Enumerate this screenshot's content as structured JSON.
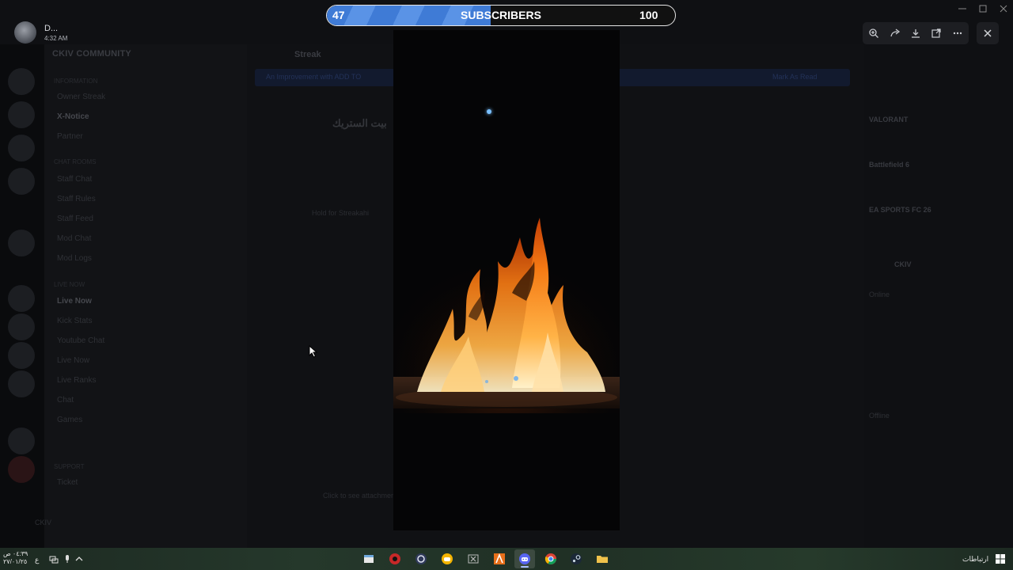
{
  "viewer": {
    "user_name": "D...",
    "time": "4:32 AM",
    "toolbar": [
      "zoom-in-icon",
      "share-icon",
      "download-icon",
      "open-external-icon",
      "more-icon"
    ]
  },
  "subscriber_goal": {
    "current": "47",
    "label": "SUBSCRIBERS",
    "goal": "100",
    "progress": 0.47,
    "fill_color": "#4a86de"
  },
  "background": {
    "server_name": "CKIV COMMUNITY",
    "channel_title": "Streak",
    "notice": "An Improvement with ADD TO",
    "notice_action": "Mark As Read",
    "arabic_title": "بيت الستريك",
    "chat_lines": [
      "Hold for Streakahi",
      "Click to see attachment"
    ],
    "channel_categories": [
      "Information",
      "Chat Rooms",
      "Live Now",
      "Support"
    ],
    "channels": [
      "Owner Streak",
      "X-Notice",
      "Partner",
      "Staff Chat",
      "Staff Rules",
      "Staff Feed",
      "Mod Chat",
      "Mod Logs",
      "Live Now",
      "Kick Stats",
      "Youtube Chat",
      "Live Now",
      "Live Ranks",
      "Chat",
      "Games",
      "Ticket"
    ],
    "members": [
      "VALORANT",
      "Battlefield 6",
      "EA SPORTS FC 26",
      "CKIV",
      "Online",
      "Offline"
    ],
    "user_panel": "CKIV"
  },
  "taskbar": {
    "clock_time": "٠٤:٣٩ ص",
    "clock_date": "٢٧/٠١/٢٥",
    "lang": "ع",
    "right_label": "ارتباطات",
    "apps": [
      "file-explorer-icon",
      "record-icon",
      "obs-icon",
      "discord-yellow-icon",
      "excel-icon",
      "aseprite-icon",
      "discord-icon",
      "chrome-icon",
      "steam-icon",
      "folder-icon"
    ]
  },
  "colors": {
    "accent_blue": "#4a86de",
    "fire_orange": "#ff8a1e",
    "spark": "#7ac0ff"
  }
}
